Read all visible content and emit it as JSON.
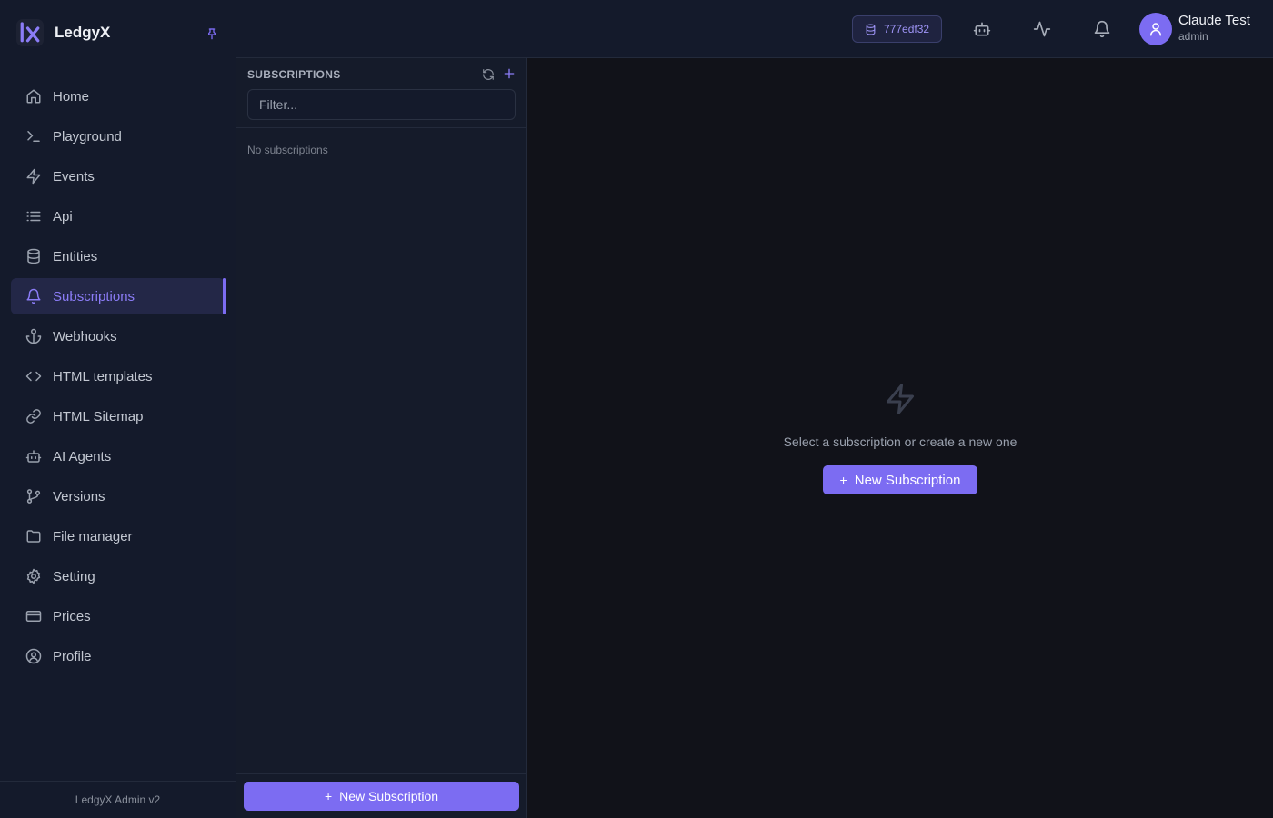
{
  "brand": {
    "name": "LedgyX"
  },
  "sidebar": {
    "items": [
      {
        "label": "Home",
        "icon": "home-icon"
      },
      {
        "label": "Playground",
        "icon": "terminal-icon"
      },
      {
        "label": "Events",
        "icon": "bolt-icon"
      },
      {
        "label": "Api",
        "icon": "list-icon"
      },
      {
        "label": "Entities",
        "icon": "database-icon"
      },
      {
        "label": "Subscriptions",
        "icon": "bell-icon",
        "active": true
      },
      {
        "label": "Webhooks",
        "icon": "anchor-icon"
      },
      {
        "label": "HTML templates",
        "icon": "code-icon"
      },
      {
        "label": "HTML Sitemap",
        "icon": "link-icon"
      },
      {
        "label": "AI Agents",
        "icon": "bot-icon"
      },
      {
        "label": "Versions",
        "icon": "git-branch-icon"
      },
      {
        "label": "File manager",
        "icon": "folder-icon"
      },
      {
        "label": "Setting",
        "icon": "gear-icon"
      },
      {
        "label": "Prices",
        "icon": "credit-card-icon"
      },
      {
        "label": "Profile",
        "icon": "user-circle-icon"
      }
    ],
    "footer": "LedgyX Admin v2"
  },
  "topbar": {
    "db_id": "777edf32",
    "user_name": "Claude Test",
    "user_role": "admin"
  },
  "panel": {
    "title": "SUBSCRIPTIONS",
    "filter_placeholder": "Filter...",
    "filter_value": "",
    "empty": "No subscriptions",
    "new_button": "New Subscription"
  },
  "main": {
    "empty_message": "Select a subscription or create a new one",
    "new_button": "New Subscription"
  },
  "colors": {
    "accent": "#7c6cf2",
    "background": "#111219",
    "sidebar": "#141a2b"
  }
}
